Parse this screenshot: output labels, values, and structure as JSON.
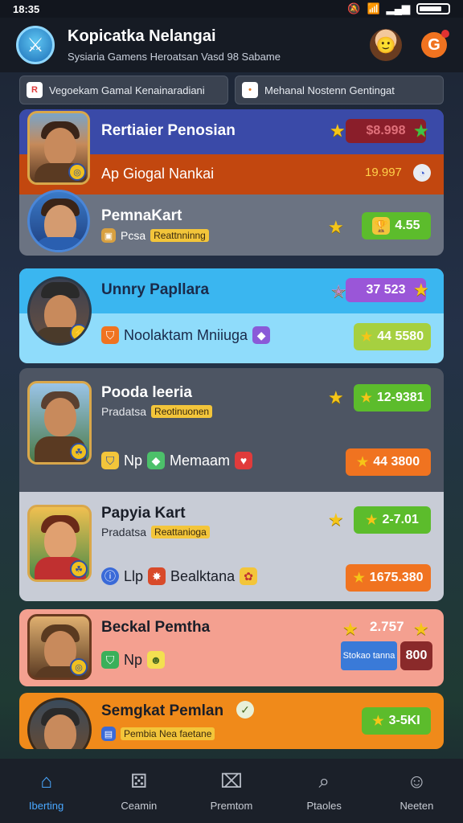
{
  "status": {
    "time": "18:35",
    "battery_level": 0.8
  },
  "header": {
    "title": "Kopicatka Nelangai",
    "subtitle": "Sysiaria Gamens Heroatsan Vasd 98 Sabame"
  },
  "filters": [
    {
      "label": "Vegoekam Gamal Kenainaradiani",
      "icon": "R",
      "icon_color": "#e03b3b"
    },
    {
      "label": "Mehanal Nostenn Gentingat",
      "icon": "•",
      "icon_color": "#e07a2a"
    }
  ],
  "cards": [
    {
      "title": "Rertiaier Penosian",
      "subtitle": "Ap Giogal Nankai",
      "value": "$8.998",
      "sub_value": "19.997",
      "colors": {
        "top": "#3a4aa8",
        "bottom": "#c2470f"
      }
    },
    {
      "title": "PemnaKart",
      "subtitle": "Pcsa",
      "tag": "Reattnninng",
      "value": "4.55"
    },
    {
      "title": "Unnry Papllara",
      "subtitle": "Noolaktam Mniiuga",
      "value": "37 523",
      "sub_value": "44 5580",
      "colors": {
        "top": "#3ab6f0",
        "bottom": "#8fdcfb"
      }
    },
    {
      "title": "Pooda leeria",
      "subtitle": "Pradatsa",
      "tag": "Reotinuonen",
      "value": "12-9381",
      "chips": [
        "Np",
        "Memaam"
      ],
      "sub_value": "44 3800"
    },
    {
      "title": "Papyia Kart",
      "subtitle": "Pradatsa",
      "tag": "Reattanioga",
      "value": "2-7.01",
      "chips": [
        "Llp",
        "Bealktana"
      ],
      "sub_value": "1675.380"
    },
    {
      "title": "Beckal Pemtha",
      "value": "2.757",
      "chips": [
        "Np"
      ],
      "box_label": "Stokao tanna",
      "box_value": "800"
    },
    {
      "title": "Semgkat Pemlan",
      "subtitle": "Pembia Nea faetane",
      "value": "3-5KI"
    }
  ],
  "tabs": [
    {
      "label": "Iberting",
      "icon": "home-icon"
    },
    {
      "label": "Ceamin",
      "icon": "dice-icon"
    },
    {
      "label": "Premtom",
      "icon": "box-icon"
    },
    {
      "label": "Ptaoles",
      "icon": "search-icon"
    },
    {
      "label": "Neeten",
      "icon": "smile-icon"
    }
  ]
}
